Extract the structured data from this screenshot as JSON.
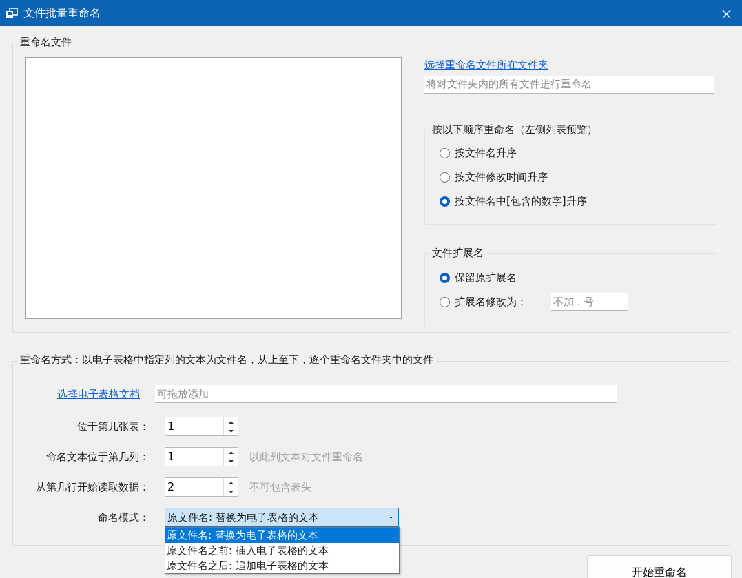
{
  "window": {
    "title": "文件批量重命名"
  },
  "files_group": {
    "title": "重命名文件",
    "folder_link": "选择重命名文件所在文件夹",
    "folder_field": {
      "placeholder": "将对文件夹内的所有文件进行重命名"
    },
    "sort_group": {
      "title": "按以下顺序重命名（左侧列表预览）",
      "options": [
        {
          "label": "按文件名升序",
          "selected": false
        },
        {
          "label": "按文件修改时间升序",
          "selected": false
        },
        {
          "label": "按文件名中[包含的数字]升序",
          "selected": true
        }
      ]
    },
    "extension_group": {
      "title": "文件扩展名",
      "options": [
        {
          "label": "保留原扩展名",
          "selected": true
        },
        {
          "label": "扩展名修改为：",
          "selected": false,
          "field": {
            "placeholder": "不加 . 号"
          }
        }
      ]
    }
  },
  "spreadsheet_group": {
    "title": "重命名方式：以电子表格中指定列的文本为文件名，从上至下，逐个重命名文件夹中的文件",
    "file_link": "选择电子表格文档",
    "file_field": {
      "placeholder": "可拖放添加"
    },
    "spinners": [
      {
        "label": "位于第几张表：",
        "value": "1"
      },
      {
        "label": "命名文本位于第几列：",
        "value": "1",
        "hint": "以此列文本对文件重命名"
      },
      {
        "label": "从第几行开始读取数据：",
        "value": "2",
        "hint": "不可包含表头"
      }
    ],
    "mode": {
      "label": "命名模式：",
      "value": "原文件名: 替换为电子表格的文本",
      "expanded": true,
      "options": [
        {
          "label": "原文件名: 替换为电子表格的文本",
          "selected": true
        },
        {
          "label": "原文件名之前: 插入电子表格的文本",
          "selected": false
        },
        {
          "label": "原文件名之后: 追加电子表格的文本",
          "selected": false
        }
      ]
    }
  },
  "start_button": "开始重命名"
}
